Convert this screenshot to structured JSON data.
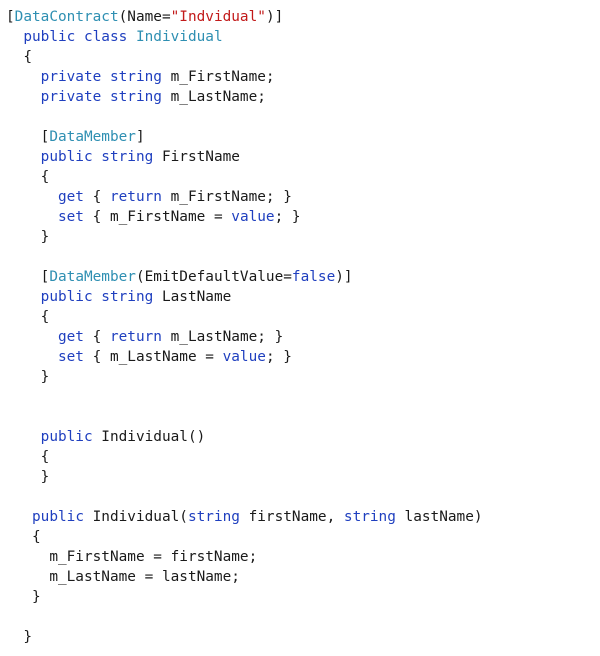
{
  "editor": {
    "colors": {
      "keyword": "#1f3fbf",
      "type": "#2e8fb2",
      "string": "#c21a1a",
      "plain": "#1a1a1a",
      "background": "#ffffff"
    },
    "lines": [
      {
        "tokens": [
          {
            "t": "[",
            "k": "plain"
          },
          {
            "t": "DataContract",
            "k": "type"
          },
          {
            "t": "(Name=",
            "k": "plain"
          },
          {
            "t": "\"Indvidual\"",
            "k": "str"
          },
          {
            "t": ")]",
            "k": "plain"
          }
        ]
      },
      {
        "tokens": [
          {
            "t": "  ",
            "k": "plain"
          },
          {
            "t": "public class",
            "k": "kw"
          },
          {
            "t": " ",
            "k": "plain"
          },
          {
            "t": "Individual",
            "k": "type"
          }
        ]
      },
      {
        "tokens": [
          {
            "t": "  {",
            "k": "plain"
          }
        ]
      },
      {
        "tokens": [
          {
            "t": "    ",
            "k": "plain"
          },
          {
            "t": "private string",
            "k": "kw"
          },
          {
            "t": " m_FirstName;",
            "k": "plain"
          }
        ]
      },
      {
        "tokens": [
          {
            "t": "    ",
            "k": "plain"
          },
          {
            "t": "private string",
            "k": "kw"
          },
          {
            "t": " m_LastName;",
            "k": "plain"
          }
        ]
      },
      {
        "tokens": [
          {
            "t": "",
            "k": "plain"
          }
        ]
      },
      {
        "tokens": [
          {
            "t": "    [",
            "k": "plain"
          },
          {
            "t": "DataMember",
            "k": "type"
          },
          {
            "t": "]",
            "k": "plain"
          }
        ]
      },
      {
        "tokens": [
          {
            "t": "    ",
            "k": "plain"
          },
          {
            "t": "public string",
            "k": "kw"
          },
          {
            "t": " FirstName",
            "k": "plain"
          }
        ]
      },
      {
        "tokens": [
          {
            "t": "    {",
            "k": "plain"
          }
        ]
      },
      {
        "tokens": [
          {
            "t": "      ",
            "k": "plain"
          },
          {
            "t": "get",
            "k": "kw"
          },
          {
            "t": " { ",
            "k": "plain"
          },
          {
            "t": "return",
            "k": "kw"
          },
          {
            "t": " m_FirstName; }",
            "k": "plain"
          }
        ]
      },
      {
        "tokens": [
          {
            "t": "      ",
            "k": "plain"
          },
          {
            "t": "set",
            "k": "kw"
          },
          {
            "t": " { m_FirstName = ",
            "k": "plain"
          },
          {
            "t": "value",
            "k": "kw"
          },
          {
            "t": "; }",
            "k": "plain"
          }
        ]
      },
      {
        "tokens": [
          {
            "t": "    }",
            "k": "plain"
          }
        ]
      },
      {
        "tokens": [
          {
            "t": "",
            "k": "plain"
          }
        ]
      },
      {
        "tokens": [
          {
            "t": "    [",
            "k": "plain"
          },
          {
            "t": "DataMember",
            "k": "type"
          },
          {
            "t": "(EmitDefaultValue=",
            "k": "plain"
          },
          {
            "t": "false",
            "k": "kw"
          },
          {
            "t": ")]",
            "k": "plain"
          }
        ]
      },
      {
        "tokens": [
          {
            "t": "    ",
            "k": "plain"
          },
          {
            "t": "public string",
            "k": "kw"
          },
          {
            "t": " LastName",
            "k": "plain"
          }
        ]
      },
      {
        "tokens": [
          {
            "t": "    {",
            "k": "plain"
          }
        ]
      },
      {
        "tokens": [
          {
            "t": "      ",
            "k": "plain"
          },
          {
            "t": "get",
            "k": "kw"
          },
          {
            "t": " { ",
            "k": "plain"
          },
          {
            "t": "return",
            "k": "kw"
          },
          {
            "t": " m_LastName; }",
            "k": "plain"
          }
        ]
      },
      {
        "tokens": [
          {
            "t": "      ",
            "k": "plain"
          },
          {
            "t": "set",
            "k": "kw"
          },
          {
            "t": " { m_LastName = ",
            "k": "plain"
          },
          {
            "t": "value",
            "k": "kw"
          },
          {
            "t": "; }",
            "k": "plain"
          }
        ]
      },
      {
        "tokens": [
          {
            "t": "    }",
            "k": "plain"
          }
        ]
      },
      {
        "tokens": [
          {
            "t": "",
            "k": "plain"
          }
        ]
      },
      {
        "tokens": [
          {
            "t": "",
            "k": "plain"
          }
        ]
      },
      {
        "tokens": [
          {
            "t": "    ",
            "k": "plain"
          },
          {
            "t": "public",
            "k": "kw"
          },
          {
            "t": " Individual()",
            "k": "plain"
          }
        ]
      },
      {
        "tokens": [
          {
            "t": "    {",
            "k": "plain"
          }
        ]
      },
      {
        "tokens": [
          {
            "t": "    }",
            "k": "plain"
          }
        ]
      },
      {
        "tokens": [
          {
            "t": "",
            "k": "plain"
          }
        ]
      },
      {
        "tokens": [
          {
            "t": "   ",
            "k": "plain"
          },
          {
            "t": "public",
            "k": "kw"
          },
          {
            "t": " Individual(",
            "k": "plain"
          },
          {
            "t": "string",
            "k": "kw"
          },
          {
            "t": " firstName, ",
            "k": "plain"
          },
          {
            "t": "string",
            "k": "kw"
          },
          {
            "t": " lastName)",
            "k": "plain"
          }
        ]
      },
      {
        "tokens": [
          {
            "t": "   {",
            "k": "plain"
          }
        ]
      },
      {
        "tokens": [
          {
            "t": "     m_FirstName = firstName;",
            "k": "plain"
          }
        ]
      },
      {
        "tokens": [
          {
            "t": "     m_LastName = lastName;",
            "k": "plain"
          }
        ]
      },
      {
        "tokens": [
          {
            "t": "   }",
            "k": "plain"
          }
        ]
      },
      {
        "tokens": [
          {
            "t": "",
            "k": "plain"
          }
        ]
      },
      {
        "tokens": [
          {
            "t": "  }",
            "k": "plain"
          }
        ]
      }
    ]
  }
}
